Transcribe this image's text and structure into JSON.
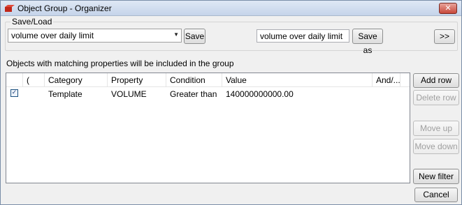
{
  "window": {
    "title": "Object Group - Organizer",
    "close_glyph": "✕"
  },
  "save_load": {
    "group_label": "Save/Load",
    "combo_value": "volume over daily limit",
    "save_label": "Save",
    "name_input_value": "volume over daily limit",
    "save_as_label": "Save as",
    "expand_label": ">>"
  },
  "info": "Objects with matching properties will be included in the group",
  "table": {
    "headers": [
      "(",
      "Category",
      "Property",
      "Condition",
      "Value",
      "And/..."
    ],
    "rows": [
      {
        "checked": true,
        "paren": "",
        "category": "Template",
        "property": "VOLUME",
        "condition": "Greater than",
        "value": "140000000000.00",
        "and_or": ""
      }
    ]
  },
  "side_buttons": {
    "add_row": "Add row",
    "delete_row": "Delete row",
    "move_up": "Move up",
    "move_down": "Move down",
    "new_filter": "New filter",
    "cancel": "Cancel"
  },
  "icons": {
    "app": "red-folder-icon",
    "checkbox": "check-icon",
    "combo": "chevron-down-icon"
  },
  "colors": {
    "title_bg": "#c5d4ea",
    "close_bg": "#c7473a",
    "disabled_text": "#a0a0a0"
  }
}
